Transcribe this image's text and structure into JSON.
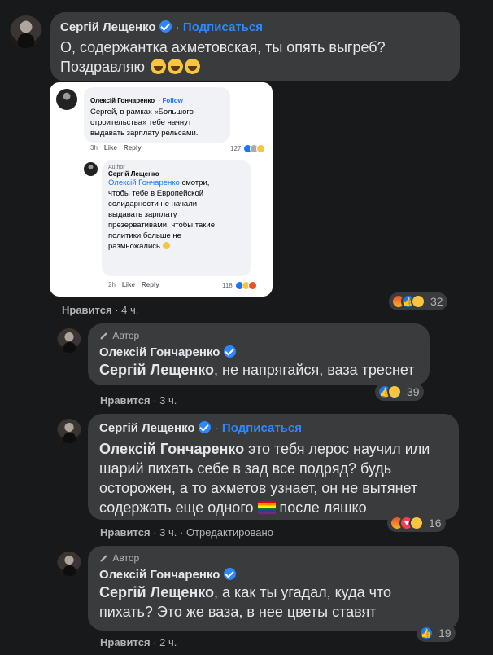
{
  "comments": [
    {
      "author": "Сергій Лещенко",
      "subscribe": "Подписаться",
      "text": "О, содержантка ахметовская, ты опять выгреб?",
      "text2": "Поздравляю",
      "meta": {
        "like": "Нравится",
        "time": "4 ч."
      },
      "reactions_count": "32"
    },
    {
      "author_tag": "Автор",
      "author": "Олексій Гончаренко",
      "mention": "Сергій Лещенко",
      "text": ", не напрягайся, ваза треснет",
      "meta": {
        "like": "Нравится",
        "time": "3 ч."
      },
      "reactions_count": "39"
    },
    {
      "author": "Сергій Лещенко",
      "subscribe": "Подписаться",
      "mention": "Олексій Гончаренко",
      "text_l1": " это тебя лерос научил или",
      "text_l2": "шарий пихать себе в зад все подряд? будь",
      "text_l3": "осторожен, а то ахметов узнает, он не вытянет",
      "text_l4a": "содержать еще одного",
      "text_l4b": "после ляшко",
      "meta": {
        "like": "Нравится",
        "time": "3 ч.",
        "edited": "Отредактировано"
      },
      "reactions_count": "16"
    },
    {
      "author_tag": "Автор",
      "author": "Олексій Гончаренко",
      "mention": "Сергій Лещенко",
      "text_l1": ", а как ты угадал, куда что",
      "text_l2": "пихать? Это же ваза, в нее цветы ставят",
      "meta": {
        "like": "Нравится",
        "time": "2 ч."
      },
      "reactions_count": "19"
    }
  ],
  "embedded": {
    "c1": {
      "author": "Олексій Гончаренко",
      "follow": "Follow",
      "l1": "Сергей, в рамках «Большого",
      "l2": "строительства» тебе начнут",
      "l3": "выдавать зарплату рельсами.",
      "time": "3h",
      "like": "Like",
      "reply": "Reply",
      "count": "127"
    },
    "c2": {
      "tag": "Author",
      "author": "Сергій Лещенко",
      "mention": "Олексій Гончаренко",
      "l1": " смотри,",
      "l2": "чтобы тебе в Европейской",
      "l3": "солидарности не начали",
      "l4": "выдавать зарплату",
      "l5": "презервативами, чтобы такие",
      "l6": "политики больше не",
      "l7": "размножались",
      "time": "2h",
      "like": "Like",
      "reply": "Reply",
      "count": "118"
    }
  },
  "sep": "·",
  "icons": [
    "verified-icon",
    "pencil-icon",
    "like-reaction-icon",
    "angry-reaction-icon",
    "haha-reaction-icon",
    "love-reaction-icon",
    "laughing-emoji-icon",
    "rainbow-flag-icon"
  ],
  "colors": {
    "background": "#18191a",
    "bubble": "#3a3b3c",
    "link": "#2d88ff",
    "text": "#e4e6eb",
    "muted": "#b0b3b8"
  }
}
